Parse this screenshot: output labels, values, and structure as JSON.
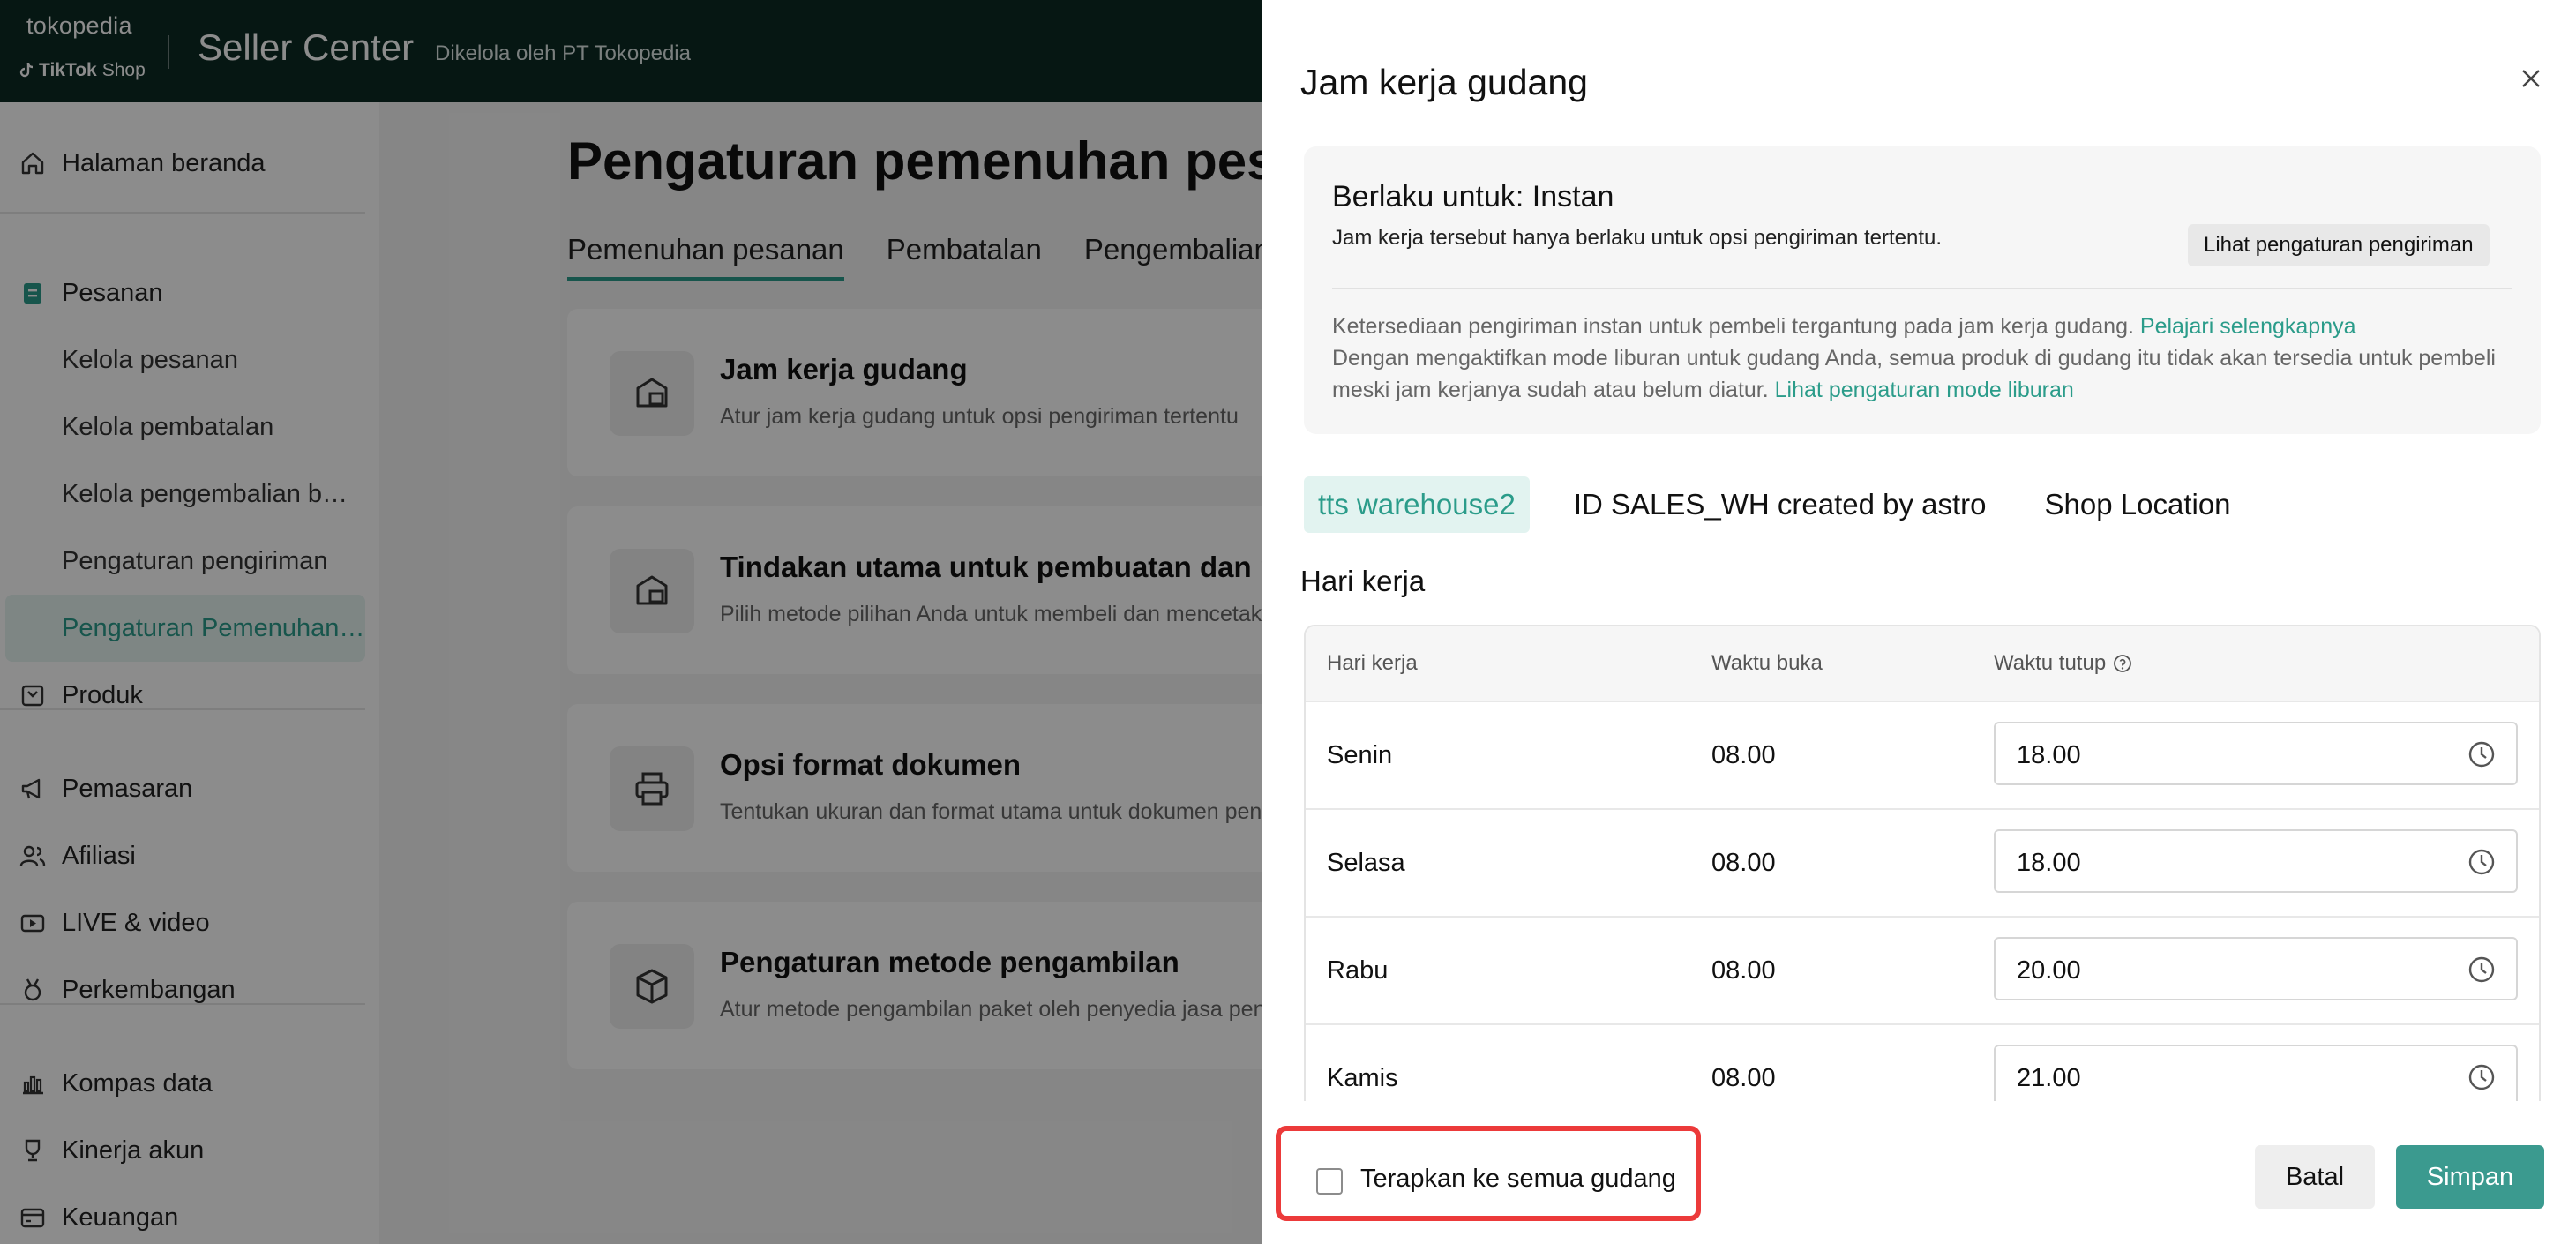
{
  "colors": {
    "brand_dark": "#0b2a24",
    "accent": "#2b9c8a",
    "save_button": "#3b9a8f",
    "highlight_box": "#ec3a3a"
  },
  "header": {
    "brand_top": "tokopedia",
    "brand_bottom_bold": "TikTok",
    "brand_bottom": "Shop",
    "title": "Seller Center",
    "subtitle": "Dikelola oleh PT Tokopedia"
  },
  "sidebar": {
    "items": [
      {
        "label": "Halaman beranda",
        "icon": "home-icon"
      },
      {
        "label": "Pesanan",
        "icon": "order-icon"
      },
      {
        "label": "Kelola pesanan"
      },
      {
        "label": "Kelola pembatalan"
      },
      {
        "label": "Kelola pengembalian b…"
      },
      {
        "label": "Pengaturan pengiriman"
      },
      {
        "label": "Pengaturan Pemenuhan…"
      },
      {
        "label": "Produk",
        "icon": "product-icon"
      },
      {
        "label": "Pemasaran",
        "icon": "megaphone-icon"
      },
      {
        "label": "Afiliasi",
        "icon": "people-icon"
      },
      {
        "label": "LIVE & video",
        "icon": "video-icon"
      },
      {
        "label": "Perkembangan",
        "icon": "medal-icon"
      },
      {
        "label": "Kompas data",
        "icon": "bar-chart-icon"
      },
      {
        "label": "Kinerja akun",
        "icon": "trophy-icon"
      },
      {
        "label": "Keuangan",
        "icon": "wallet-icon"
      }
    ]
  },
  "main": {
    "title": "Pengaturan pemenuhan pesanan",
    "tabs": [
      "Pemenuhan pesanan",
      "Pembatalan",
      "Pengembalian"
    ],
    "cards": [
      {
        "title": "Jam kerja gudang",
        "desc": "Atur jam kerja gudang untuk opsi pengiriman tertentu",
        "icon": "warehouse-clock-icon"
      },
      {
        "title": "Tindakan utama untuk pembuatan dan pencetakan",
        "desc": "Pilih metode pilihan Anda untuk membeli dan mencetak label pengiriman",
        "icon": "warehouse-print-icon"
      },
      {
        "title": "Opsi format dokumen",
        "desc": "Tentukan ukuran dan format utama untuk dokumen pengiriman",
        "icon": "printer-icon"
      },
      {
        "title": "Pengaturan metode pengambilan",
        "desc": "Atur metode pengambilan paket oleh penyedia jasa pengiriman",
        "icon": "package-icon"
      }
    ]
  },
  "drawer": {
    "title": "Jam kerja gudang",
    "info": {
      "title": "Berlaku untuk: Instan",
      "desc": "Jam kerja tersebut hanya berlaku untuk opsi pengiriman tertentu.",
      "button": "Lihat pengaturan pengiriman",
      "note1": "Ketersediaan pengiriman instan untuk pembeli tergantung pada jam kerja gudang.",
      "note1_link": "Pelajari selengkapnya",
      "note2": "Dengan mengaktifkan mode liburan untuk gudang Anda, semua produk di gudang itu tidak akan tersedia untuk pembeli meski jam kerjanya sudah atau belum diatur.",
      "note2_link": "Lihat pengaturan mode liburan"
    },
    "warehouse_tabs": [
      "tts warehouse2",
      "ID SALES_WH created by astro",
      "Shop Location"
    ],
    "section_title": "Hari kerja",
    "table": {
      "headers": [
        "Hari kerja",
        "Waktu buka",
        "Waktu tutup"
      ],
      "rows": [
        {
          "day": "Senin",
          "open": "08.00",
          "close": "18.00"
        },
        {
          "day": "Selasa",
          "open": "08.00",
          "close": "18.00"
        },
        {
          "day": "Rabu",
          "open": "08.00",
          "close": "20.00"
        },
        {
          "day": "Kamis",
          "open": "08.00",
          "close": "21.00"
        }
      ]
    },
    "footer": {
      "apply_all_label": "Terapkan ke semua gudang",
      "apply_all_checked": false,
      "cancel": "Batal",
      "save": "Simpan"
    }
  }
}
